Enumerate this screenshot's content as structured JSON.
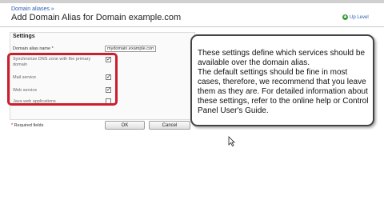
{
  "breadcrumb": "Domain aliases »",
  "title": "Add Domain Alias for Domain example.com",
  "up_level": "Up Level",
  "settings": {
    "legend": "Settings",
    "alias_label": "Domain alias name *",
    "alias_value": "mydomain.example.com",
    "options": [
      {
        "label": "Synchronize DNS zone with the primary domain",
        "checked": true
      },
      {
        "label": "Mail service",
        "checked": true
      },
      {
        "label": "Web service",
        "checked": true
      },
      {
        "label": "Java web applications",
        "checked": false
      }
    ]
  },
  "required_note": {
    "star": "*",
    "text": "Required fields"
  },
  "buttons": {
    "ok": "OK",
    "cancel": "Cancel"
  },
  "callout": {
    "line1": "These settings define which services should be available over the domain alias.",
    "line2": "The default settings should be fine in most cases, therefore, we recommend that you leave them as they are. For detailed information about these settings, refer to the online help or Control Panel User's Guide."
  },
  "colors": {
    "highlight": "#cc1f2d",
    "link": "#2a5db0"
  },
  "icons": {
    "up_level": "up-arrow-icon",
    "cursor": "mouse-pointer-icon"
  }
}
